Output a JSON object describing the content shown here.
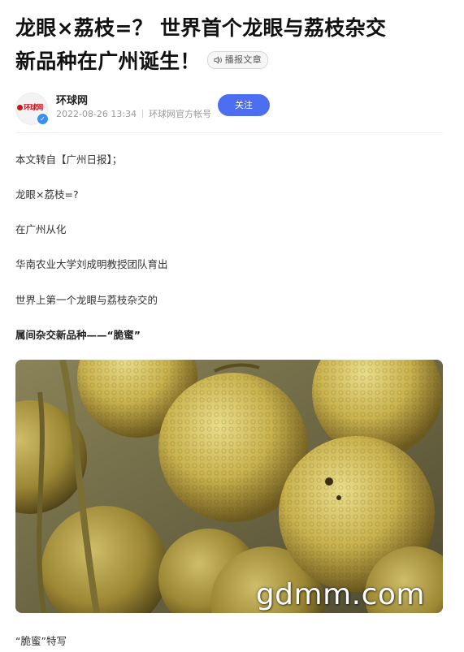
{
  "article": {
    "title_line1": "龙眼×荔枝=？ 世界首个龙眼与荔枝杂交",
    "title_line2": "新品种在广州诞生！",
    "listen_label": "播报文章"
  },
  "author": {
    "name": "环球网",
    "avatar_text": "环球网",
    "date": "2022-08-26 13:34",
    "account_type": "环球网官方帐号",
    "follow_label": "关注",
    "verified_mark": "✓"
  },
  "body": {
    "paragraphs": [
      "本文转自【广州日报】；",
      "龙眼×荔枝=?",
      "在广州从化",
      "华南农业大学刘成明教授团队育出",
      "世界上第一个龙眼与荔枝杂交的",
      "属间杂交新品种——“脆蜜”"
    ],
    "image_watermark": "gdmm.com",
    "image_caption": "“脆蜜”特写"
  },
  "colors": {
    "accent": "#4e6ef2",
    "brand_red": "#c4161c",
    "verified_blue": "#3a8ff3"
  },
  "icons": {
    "listen": "speaker-icon",
    "verified": "verified-check-icon"
  }
}
